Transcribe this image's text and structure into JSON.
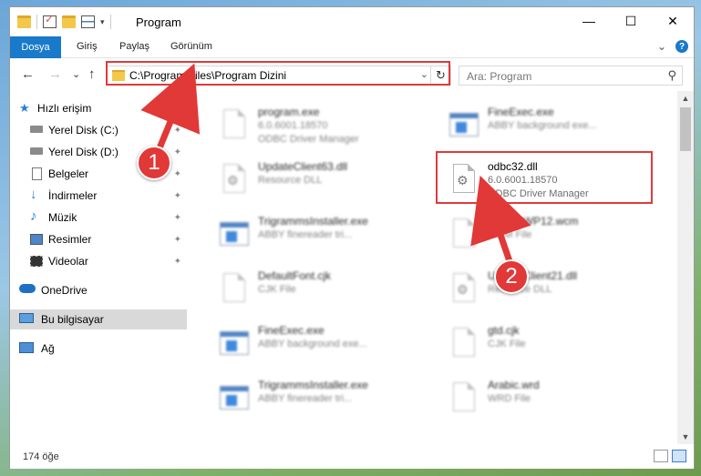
{
  "window": {
    "title": "Program",
    "controls": {
      "minimize": "—",
      "maximize": "☐",
      "close": "✕"
    }
  },
  "ribbon": {
    "tabs": [
      "Dosya",
      "Giriş",
      "Paylaş",
      "Görünüm"
    ],
    "expand_glyph": "⌄",
    "help": "?"
  },
  "nav": {
    "back": "←",
    "forward": "→",
    "recent": "⌄",
    "up": "↑",
    "address": "C:\\Program Files\\Program Dizini",
    "address_dropdown": "⌄",
    "refresh": "↻",
    "search_placeholder": "Ara: Program",
    "search_icon_glyph": "⚲"
  },
  "sidebar": {
    "items": [
      {
        "label": "Hızlı erişim",
        "icon": "star-icon",
        "pinned": false
      },
      {
        "label": "Yerel Disk (C:)",
        "icon": "drive-icon",
        "pinned": true
      },
      {
        "label": "Yerel Disk (D:)",
        "icon": "drive-icon",
        "pinned": true
      },
      {
        "label": "Belgeler",
        "icon": "documents-icon",
        "pinned": true
      },
      {
        "label": "İndirmeler",
        "icon": "download-icon",
        "pinned": true
      },
      {
        "label": "Müzik",
        "icon": "music-icon",
        "pinned": true
      },
      {
        "label": "Resimler",
        "icon": "pictures-icon",
        "pinned": true
      },
      {
        "label": "Videolar",
        "icon": "videos-icon",
        "pinned": true
      },
      {
        "label": "OneDrive",
        "icon": "cloud-icon",
        "pinned": false
      },
      {
        "label": "Bu bilgisayar",
        "icon": "computer-icon",
        "pinned": false,
        "selected": true
      },
      {
        "label": "Ağ",
        "icon": "network-icon",
        "pinned": false
      }
    ],
    "pin_glyph": "📌"
  },
  "files": [
    {
      "name": "program.exe",
      "line2": "6.0.6001.18570",
      "line3": "ODBC Driver Manager",
      "icon": "installer-icon",
      "blurred": true
    },
    {
      "name": "FineExec.exe",
      "line2": "ABBY background exe...",
      "line3": "",
      "icon": "exe-icon",
      "blurred": true
    },
    {
      "name": "UpdateClient63.dll",
      "line2": "Resource DLL",
      "line3": "",
      "icon": "dll-icon",
      "blurred": true
    },
    {
      "name": "odbc32.dll",
      "line2": "6.0.6001.18570",
      "line3": "ODBC Driver Manager",
      "icon": "dll-icon",
      "blurred": false
    },
    {
      "name": "TrigrammsInstaller.exe",
      "line2": "ABBY finereader tri...",
      "line3": "",
      "icon": "exe-icon",
      "blurred": true
    },
    {
      "name": "AccessWP12.wcm",
      "line2": "WCM File",
      "line3": "",
      "icon": "file-icon",
      "blurred": true
    },
    {
      "name": "DefaultFont.cjk",
      "line2": "CJK File",
      "line3": "",
      "icon": "file-icon",
      "blurred": true
    },
    {
      "name": "UpdateClient21.dll",
      "line2": "Resource DLL",
      "line3": "",
      "icon": "dll-icon",
      "blurred": true
    },
    {
      "name": "FineExec.exe",
      "line2": "ABBY background exe...",
      "line3": "",
      "icon": "exe-icon",
      "blurred": true
    },
    {
      "name": "gtd.cjk",
      "line2": "CJK File",
      "line3": "",
      "icon": "file-icon",
      "blurred": true
    },
    {
      "name": "TrigrammsInstaller.exe",
      "line2": "ABBY finereader tri...",
      "line3": "",
      "icon": "exe-icon",
      "blurred": true
    },
    {
      "name": "Arabic.wrd",
      "line2": "WRD File",
      "line3": "",
      "icon": "file-icon",
      "blurred": true
    }
  ],
  "status": {
    "count": "174 öğe"
  },
  "markers": [
    {
      "label": "1"
    },
    {
      "label": "2"
    }
  ],
  "colors": {
    "accent": "#1979ca",
    "highlight": "#e03a3a"
  }
}
